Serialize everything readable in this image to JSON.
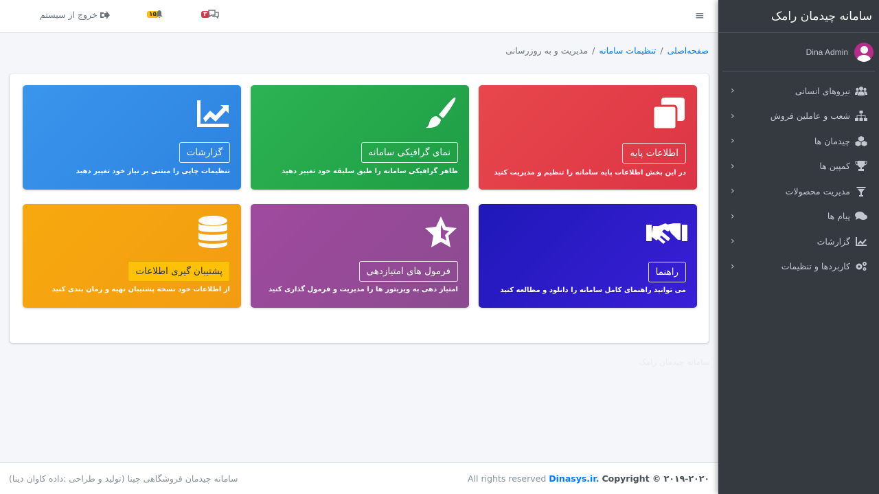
{
  "sidebar": {
    "brand": "سامانه چیدمان رامک",
    "user_name": "Dina Admin",
    "items": [
      {
        "label": "نیروهای انسانی",
        "icon": "users-icon"
      },
      {
        "label": "شعب و عاملین فروش",
        "icon": "sitemap-icon"
      },
      {
        "label": "چیدمان ها",
        "icon": "cubes-icon"
      },
      {
        "label": "کمپین ها",
        "icon": "trophy-icon"
      },
      {
        "label": "مدیریت محصولات",
        "icon": "product-icon"
      },
      {
        "label": "پیام ها",
        "icon": "comments-icon"
      },
      {
        "label": "گزارشات",
        "icon": "chart-icon"
      },
      {
        "label": "کاربردها و تنظیمات",
        "icon": "cogs-icon"
      }
    ]
  },
  "header": {
    "logout_label": "خروج از سیستم",
    "notifications_count": "۱۵",
    "messages_count": "۳"
  },
  "breadcrumb": {
    "home": "صفحه‌اصلی",
    "settings": "تنظیمات سامانه",
    "current": "مدیریت و به روزرسانی"
  },
  "tiles": [
    {
      "title": "اطلاعات پایه",
      "desc": "در این بخش اطلاعات پایه سامانه را تنظیم و مدیریت کنید",
      "icon": "copy-icon",
      "color": "#e0393f"
    },
    {
      "title": "نمای گرافیکی سامانه",
      "desc": "ظاهر گرافیکی سامانه را طبق سلیقه خود تغییر دهید",
      "icon": "brush-icon",
      "color": "#22a84a"
    },
    {
      "title": "گزارشات",
      "desc": "تنظیمات چاپی را مبتنی بر نیاز خود تغییر دهید",
      "icon": "chart-line-icon",
      "color": "#2f8be6"
    },
    {
      "title": "راهنما",
      "desc": "می توانید راهنمای کامل سامانه را دانلود و مطالعه کنید",
      "icon": "handshake-icon",
      "color": "#2a1ac7"
    },
    {
      "title": "فرمول های امتیازدهی",
      "desc": "امتیاز دهی به ویزیتور ها را مدیریت و فرمول گذاری کنید",
      "icon": "star-icon",
      "color": "#9b4a9e"
    },
    {
      "title": "پشتیبان گیری اطلاعات",
      "desc": "از اطلاعات خود نسخه پشتیبان تهیه و زمان بندی کنید",
      "icon": "database-icon",
      "color": "#f4a111"
    }
  ],
  "footer": {
    "copyright_prefix": "Copyright © ۲۰۱۹-۲۰۲۰",
    "site": "Dinasys.ir.",
    "rights": "All rights reserved",
    "left_text": "سامانه چیدمان فروشگاهی چینا (تولید و طراحی :داده کاوان دینا)"
  },
  "watermark": "سامانه چیدمان رامک"
}
